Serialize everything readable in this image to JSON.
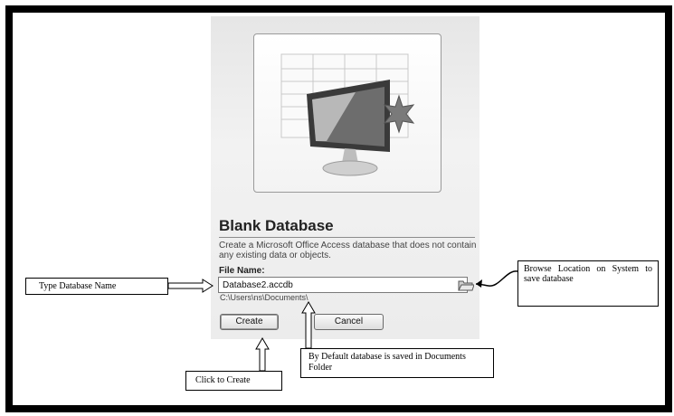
{
  "dialog": {
    "title": "Blank Database",
    "description": "Create a Microsoft Office Access database that does not contain any existing data or objects.",
    "file_name_label": "File Name:",
    "file_name_value": "Database2.accdb",
    "path": "C:\\Users\\ns\\Documents\\",
    "create_label": "Create",
    "cancel_label": "Cancel",
    "preview_icon": "blank-database-monitor-icon",
    "browse_icon": "folder-browse-icon"
  },
  "annotations": {
    "type_name": "Type Database Name",
    "browse": "Browse Location on System to save database",
    "default_folder": "By Default database is saved in Documents Folder",
    "click_create": "Click to Create"
  }
}
